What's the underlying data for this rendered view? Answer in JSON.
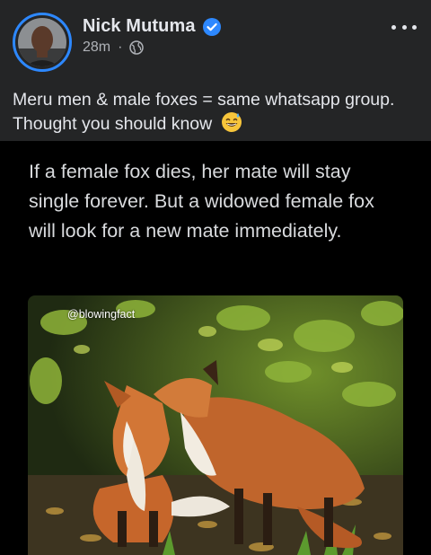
{
  "post": {
    "author": "Nick Mutuma",
    "time": "28m",
    "separator": "·",
    "text": "Meru men & male foxes = same whatsapp group. Thought you should know",
    "emoji": "sweat-smile"
  },
  "media": {
    "quote": "If a female fox dies, her mate will stay single forever. But a widowed female fox will look for a new mate immediately.",
    "watermark": "@blowingfact"
  },
  "icons": {
    "verified": "verified-badge-icon",
    "privacy": "globe-icon",
    "more": "more-options-icon"
  },
  "colors": {
    "background": "#242526",
    "accent": "#2d88ff",
    "text": "#e4e6eb",
    "secondary": "#b0b3b8"
  }
}
